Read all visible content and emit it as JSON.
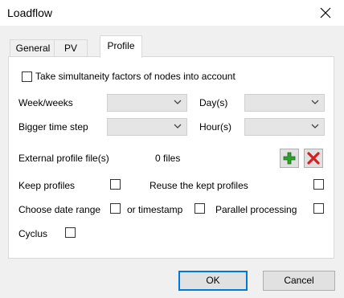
{
  "window": {
    "title": "Loadflow"
  },
  "tabs": [
    {
      "label": "General"
    },
    {
      "label": "PV"
    },
    {
      "label": "Profile"
    }
  ],
  "profile": {
    "simultaneity_label": "Take simultaneity factors of nodes into account",
    "week_label": "Week/weeks",
    "day_label": "Day(s)",
    "bigger_step_label": "Bigger time step",
    "hour_label": "Hour(s)",
    "external_label": "External profile file(s)",
    "files_count": "0 files",
    "keep_label": "Keep profiles",
    "reuse_label": "Reuse the kept profiles",
    "date_range_label": "Choose date range",
    "timestamp_label": "or timestamp",
    "parallel_label": "Parallel processing",
    "cyclus_label": "Cyclus"
  },
  "buttons": {
    "ok": "OK",
    "cancel": "Cancel"
  },
  "icons": {
    "close": "close-icon",
    "add": "plus-icon",
    "remove": "delete-x-icon",
    "dropdown": "chevron-down-icon"
  },
  "colors": {
    "add_green": "#2e9e2e",
    "remove_red": "#d42020",
    "default_button_border": "#0078d7"
  }
}
